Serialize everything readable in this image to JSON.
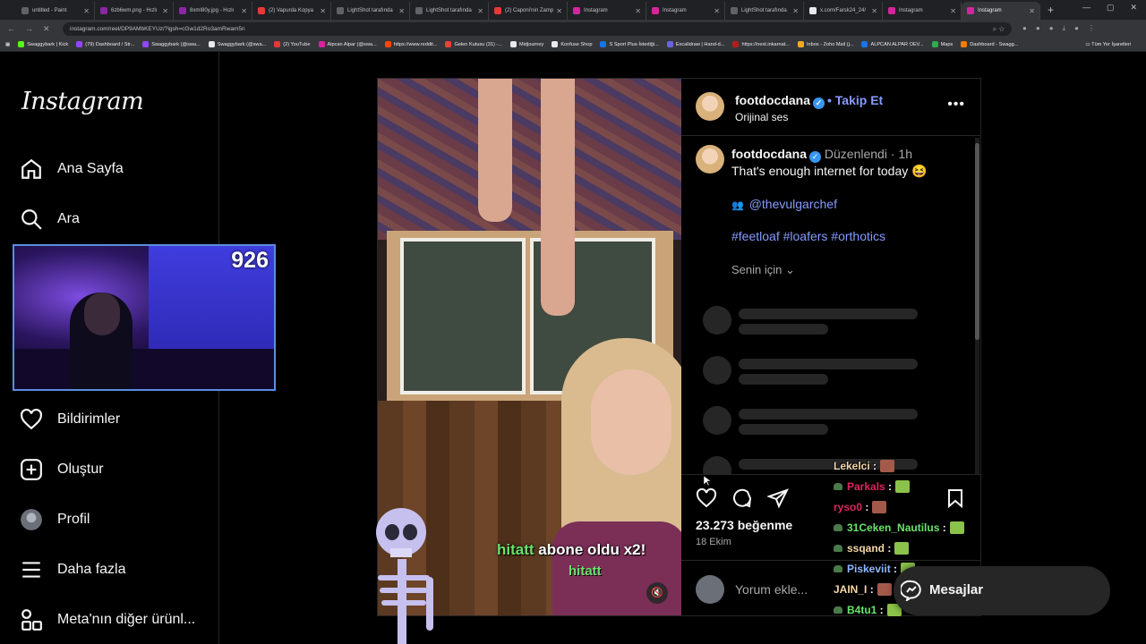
{
  "browser": {
    "tabs": [
      {
        "title": "untitled - Paint",
        "color": "#5f6368"
      },
      {
        "title": "6zb6wm.png - Hızlı",
        "color": "#8e24aa"
      },
      {
        "title": "8xmI80y.jpg - Hızlı",
        "color": "#8e24aa"
      },
      {
        "title": "(2) Vapurda Kopya",
        "color": "#e53935"
      },
      {
        "title": "LightShot tarafında",
        "color": "#5f6368"
      },
      {
        "title": "LightShot tarafında",
        "color": "#5f6368"
      },
      {
        "title": "(2) Caponi'nin Zamp",
        "color": "#e53935"
      },
      {
        "title": "Instagram",
        "color": "#d6249f"
      },
      {
        "title": "Instagram",
        "color": "#d6249f"
      },
      {
        "title": "LightShot tarafında",
        "color": "#5f6368"
      },
      {
        "title": "x.com/Farsk24_24/",
        "color": "#e8eaed"
      },
      {
        "title": "Instagram",
        "color": "#d6249f"
      },
      {
        "title": "Instagram",
        "color": "#d6249f"
      }
    ],
    "url": "instagram.com/reel/DP9AMbKEYUz/?igsh=cGw1d2Ro3amRwam5n",
    "bookmarks": [
      {
        "label": "Swaggybark | Kick",
        "color": "#53fc18"
      },
      {
        "label": "(79) Dashboard / Str...",
        "color": "#9146ff"
      },
      {
        "label": "Swaggybark (@swa...",
        "color": "#9146ff"
      },
      {
        "label": "Swaggybark (@swa...",
        "color": "#e8eaed"
      },
      {
        "label": "(2) YouTube",
        "color": "#e53935"
      },
      {
        "label": "Alpcan Alpar (@swa...",
        "color": "#d6249f"
      },
      {
        "label": "https://www.reddit...",
        "color": "#ff4500"
      },
      {
        "label": "Gelen Kutusu (31) -...",
        "color": "#ea4335"
      },
      {
        "label": "Midjourney",
        "color": "#e8eaed"
      },
      {
        "label": "Konfuse Shop",
        "color": "#e8eaed"
      },
      {
        "label": "S Sport Plus-İstediği...",
        "color": "#1a73e8"
      },
      {
        "label": "Excalidraw | Hand-d...",
        "color": "#6965db"
      },
      {
        "label": "https://next.inkarnat...",
        "color": "#b71c1c"
      },
      {
        "label": "Inbox - Zoho Mail (j...",
        "color": "#f9a825"
      },
      {
        "label": "ALPCAN ALPAR OEV...",
        "color": "#1a73e8"
      },
      {
        "label": "Maps",
        "color": "#34a853"
      },
      {
        "label": "Dashboard - Swagg...",
        "color": "#f57c00"
      }
    ],
    "all_bookmarks": "Tüm Yer İşaretleri"
  },
  "sidebar": {
    "logo": "Instagram",
    "items": [
      {
        "label": "Ana Sayfa",
        "icon": "home-icon"
      },
      {
        "label": "Ara",
        "icon": "search-icon"
      },
      {
        "label": "Bildirimler",
        "icon": "heart-icon"
      },
      {
        "label": "Oluştur",
        "icon": "create-icon"
      },
      {
        "label": "Profil",
        "icon": "profile-avatar"
      },
      {
        "label": "Daha fazla",
        "icon": "menu-icon"
      },
      {
        "label": "Meta'nın diğer ürünl...",
        "icon": "apps-icon"
      }
    ]
  },
  "stream": {
    "viewer_count": "926",
    "sub_alert_user": "hitatt",
    "sub_alert_text": " abone oldu x2!",
    "sub_alert_name": "hitatt"
  },
  "post": {
    "username": "footdocdana",
    "follow": "• Takip Et",
    "audio": "Orijinal ses",
    "caption_meta": "Düzenlendi",
    "caption_time": "1h",
    "caption_text": "That's enough internet for today 😆",
    "mention": "@thevulgarchef",
    "hashtags": "#feetloaf #loafers #orthotics",
    "for_you": "Senin için",
    "likes": "23.273 beğenme",
    "date": "18 Ekim",
    "comment_placeholder": "Yorum ekle..."
  },
  "chat": [
    {
      "user": "Lekelci",
      "color": "#f4d7a8",
      "emote": "#a35a4a",
      "badge": false
    },
    {
      "user": "Parkals",
      "color": "#e0245e",
      "emote": "#8bc34a",
      "badge": true
    },
    {
      "user": "ryso0",
      "color": "#e0245e",
      "emote": "#a35a4a",
      "badge": false
    },
    {
      "user": "31Ceken_Nautilus",
      "color": "#69e36b",
      "emote": "#8bc34a",
      "badge": true
    },
    {
      "user": "ssqand",
      "color": "#f4d7a8",
      "emote": "#8bc34a",
      "badge": true
    },
    {
      "user": "Piskeviit",
      "color": "#8fb8ff",
      "emote": "#8bc34a",
      "badge": true
    },
    {
      "user": "JAIN_I",
      "color": "#f4d7a8",
      "emote": "#a35a4a",
      "badge": false
    },
    {
      "user": "B4tu1",
      "color": "#69e36b",
      "emote": "#8bc34a",
      "badge": true
    }
  ],
  "messages_label": "Mesajlar"
}
